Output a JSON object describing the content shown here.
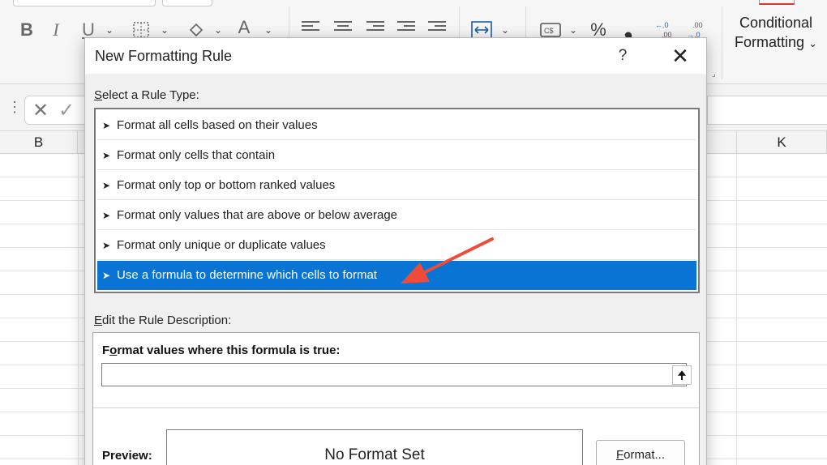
{
  "ribbon": {
    "bold_label": "B",
    "italic_label": "I",
    "underline_label": "U",
    "font_color_label": "A",
    "percent_label": "%",
    "comma_label": "❟",
    "increase_decimal_label": "←.0\n.00",
    "decrease_decimal_label": ".00\n→.0",
    "conditional_formatting_label_1": "Conditional",
    "conditional_formatting_label_2": "Formatting"
  },
  "columns": {
    "col_b": "B",
    "col_k": "K"
  },
  "dialog": {
    "title": "New Formatting Rule",
    "help_label": "?",
    "close_label": "✕",
    "select_rule_type_label": "Select a Rule Type:",
    "select_rule_type_underline": "S",
    "select_rule_type_rest": "elect a Rule Type:",
    "rule_types": [
      {
        "label": "Format all cells based on their values",
        "selected": false
      },
      {
        "label": "Format only cells that contain",
        "selected": false
      },
      {
        "label": "Format only top or bottom ranked values",
        "selected": false
      },
      {
        "label": "Format only values that are above or below average",
        "selected": false
      },
      {
        "label": "Format only unique or duplicate values",
        "selected": false
      },
      {
        "label": "Use a formula to determine which cells to format",
        "selected": true
      }
    ],
    "edit_rule_description_underline": "E",
    "edit_rule_description_rest": "dit the Rule Description:",
    "formula_heading_underline": "o",
    "formula_heading_pre": "F",
    "formula_heading_rest": "rmat values where this formula is true:",
    "formula_value": "",
    "preview_label": "Preview:",
    "preview_text": "No Format Set",
    "format_button_underline": "F",
    "format_button_rest": "ormat..."
  },
  "colors": {
    "selection": "#0a74d4",
    "annotation_arrow": "#ee4b3b",
    "dialog_bg": "#f0f0f0"
  }
}
